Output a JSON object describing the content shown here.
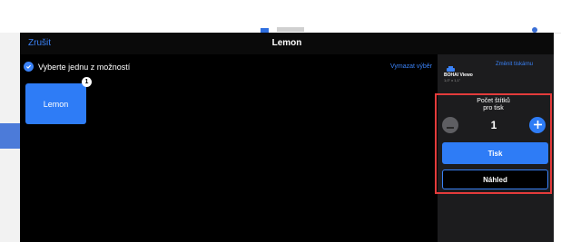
{
  "background": {
    "accent": "#2f6fe0"
  },
  "modal": {
    "cancel_label": "Zrušit",
    "title": "Lemon",
    "select_prompt": "Vyberte jednu z možností",
    "clear_label": "Vymazat výběr",
    "option": {
      "label": "Lemon",
      "badge": "1"
    }
  },
  "printer_panel": {
    "change_label": "Změnit tiskárnu",
    "printer_name": "BOHAI Viewo",
    "label_size": "1,0\" x 1,1\"",
    "count_label_line1": "Počet štítků",
    "count_label_line2": "pro tisk",
    "count_value": "1",
    "print_label": "Tisk",
    "preview_label": "Náhled"
  },
  "colors": {
    "primary_blue": "#2e7cf6",
    "modal_bg": "#000000",
    "panel_bg": "#1c1c1e",
    "highlight": "#e33b3b"
  },
  "icons": [
    "check-circle-icon",
    "printer-icon",
    "minus-icon",
    "plus-icon"
  ]
}
